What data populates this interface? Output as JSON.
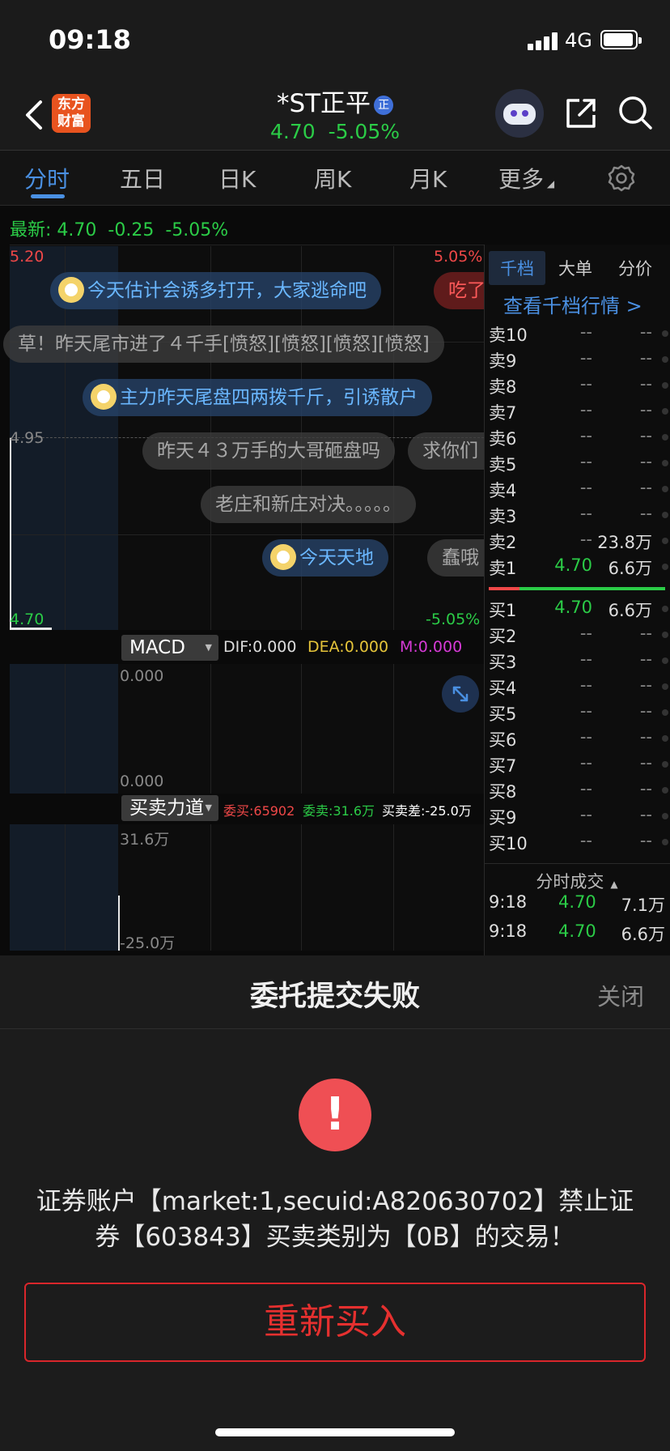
{
  "status_bar": {
    "time": "09:18",
    "network": "4G"
  },
  "header": {
    "logo_line1": "东方",
    "logo_line2": "财富",
    "stock_name": "*ST正平",
    "badge": "正",
    "price": "4.70",
    "change_pct": "-5.05%"
  },
  "tabs": [
    {
      "label": "分时"
    },
    {
      "label": "五日"
    },
    {
      "label": "日K"
    },
    {
      "label": "周K"
    },
    {
      "label": "月K"
    },
    {
      "label": "更多"
    }
  ],
  "latest": {
    "label": "最新:",
    "price": "4.70",
    "change": "-0.25",
    "pct": "-5.05%"
  },
  "chart": {
    "y_high": "5.20",
    "y_high_pct": "5.05%",
    "y_mid": "4.95",
    "y_low": "4.70",
    "y_low_pct": "-5.05%"
  },
  "danmaku": [
    "今天估计会诱多打开，大家逃命吧",
    "吃了",
    "草！昨天尾市进了４千手[愤怒][愤怒][愤怒][愤怒]",
    "主力昨天尾盘四两拨千斤，引诱散户",
    "昨天４３万手的大哥砸盘吗",
    "求你们",
    "老庄和新庄对决。。。。。",
    "今天天地",
    "蠢哦"
  ],
  "macd": {
    "selector": "MACD",
    "dif": "DIF:0.000",
    "dea": "DEA:0.000",
    "m": "M:0.000",
    "y_top": "0.000",
    "y_bottom": "0.000"
  },
  "force": {
    "selector": "买卖力道",
    "buy": "委买:65902",
    "sell": "委卖:31.6万",
    "diff": "买卖差:-25.0万",
    "y_top": "31.6万",
    "y_bottom": "-25.0万"
  },
  "right_panel": {
    "tabs": [
      "千档",
      "大单",
      "分价"
    ],
    "link": "查看千档行情 >",
    "asks": [
      {
        "label": "卖10",
        "price": "--",
        "vol": "--"
      },
      {
        "label": "卖9",
        "price": "--",
        "vol": "--"
      },
      {
        "label": "卖8",
        "price": "--",
        "vol": "--"
      },
      {
        "label": "卖7",
        "price": "--",
        "vol": "--"
      },
      {
        "label": "卖6",
        "price": "--",
        "vol": "--"
      },
      {
        "label": "卖5",
        "price": "--",
        "vol": "--"
      },
      {
        "label": "卖4",
        "price": "--",
        "vol": "--"
      },
      {
        "label": "卖3",
        "price": "--",
        "vol": "--"
      },
      {
        "label": "卖2",
        "price": "--",
        "vol": "23.8万"
      },
      {
        "label": "卖1",
        "price": "4.70",
        "vol": "6.6万"
      }
    ],
    "bids": [
      {
        "label": "买1",
        "price": "4.70",
        "vol": "6.6万"
      },
      {
        "label": "买2",
        "price": "--",
        "vol": "--"
      },
      {
        "label": "买3",
        "price": "--",
        "vol": "--"
      },
      {
        "label": "买4",
        "price": "--",
        "vol": "--"
      },
      {
        "label": "买5",
        "price": "--",
        "vol": "--"
      },
      {
        "label": "买6",
        "price": "--",
        "vol": "--"
      },
      {
        "label": "买7",
        "price": "--",
        "vol": "--"
      },
      {
        "label": "买8",
        "price": "--",
        "vol": "--"
      },
      {
        "label": "买9",
        "price": "--",
        "vol": "--"
      },
      {
        "label": "买10",
        "price": "--",
        "vol": "--"
      }
    ],
    "trades_header": "分时成交",
    "trades": [
      {
        "time": "9:18",
        "price": "4.70",
        "vol": "7.1万"
      },
      {
        "time": "9:18",
        "price": "4.70",
        "vol": "6.6万"
      }
    ]
  },
  "sheet": {
    "title": "委托提交失败",
    "close": "关闭",
    "alert_icon": "!",
    "message": "证券账户【market:1,secuid:A820630702】禁止证券【603843】买卖类别为【0B】的交易！",
    "button": "重新买入"
  },
  "colors": {
    "up": "#f04848",
    "down": "#2bcc47",
    "accent": "#4a90e2",
    "alert": "#ef4f54"
  }
}
